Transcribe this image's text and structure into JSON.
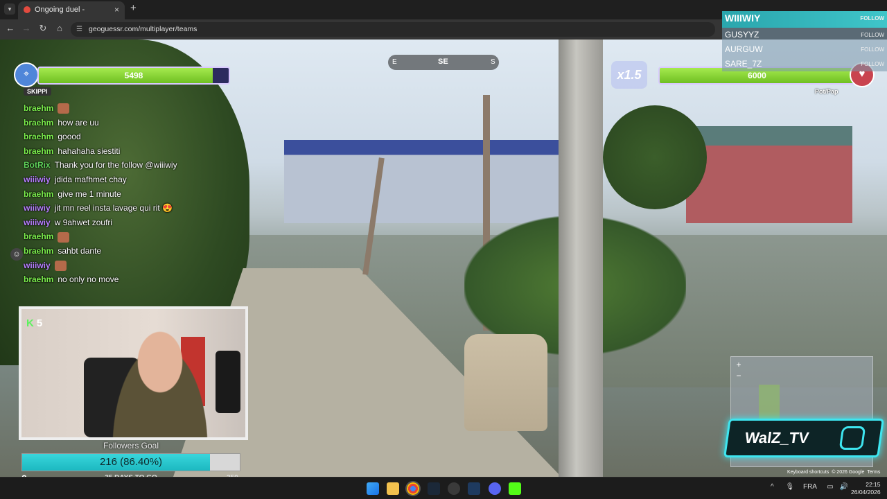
{
  "browser": {
    "tab_title": "Ongoing duel - GeoGuessr",
    "tab_close": "×",
    "new_tab": "+",
    "url": "geoguessr.com/multiplayer/teams"
  },
  "game": {
    "left_hp": "5498",
    "left_hp_fraction": 0.916,
    "right_hp": "6000",
    "right_hp_fraction": 1.0,
    "compass_left": "E",
    "compass_center": "SE",
    "compass_right": "S",
    "multiplier": "x1.5",
    "left_player_tag": "SKIPPI",
    "right_player_tag": "Pot/Pap"
  },
  "chat": [
    {
      "user": "braehm",
      "text": "",
      "color": "#7cf04d",
      "emote": true
    },
    {
      "user": "braehm",
      "text": "how are uu",
      "color": "#7cf04d"
    },
    {
      "user": "braehm",
      "text": "goood",
      "color": "#7cf04d"
    },
    {
      "user": "braehm",
      "text": "hahahaha siestiti",
      "color": "#7cf04d"
    },
    {
      "user": "BotRix",
      "text": "Thank you for the follow @wiiiwiy",
      "color": "#5fd35a"
    },
    {
      "user": "wiiiwiy",
      "text": "jdida mafhmet chay",
      "color": "#b780ff"
    },
    {
      "user": "braehm",
      "text": "give me 1 minute",
      "color": "#7cf04d"
    },
    {
      "user": "wiiiwiy",
      "text": "jit mn reel insta lavage qui rit 😍",
      "color": "#b780ff"
    },
    {
      "user": "wiiiwiy",
      "text": "w 9ahwet zoufri",
      "color": "#b780ff"
    },
    {
      "user": "braehm",
      "text": "",
      "color": "#7cf04d",
      "emote": true
    },
    {
      "user": "braehm",
      "text": "sahbt dante",
      "color": "#7cf04d"
    },
    {
      "user": "wiiiwiy",
      "text": "",
      "color": "#b780ff",
      "emote": true
    },
    {
      "user": "braehm",
      "text": "no only no move",
      "color": "#7cf04d"
    }
  ],
  "cam": {
    "kick_letter": "K",
    "viewers": "5"
  },
  "followers_goal": {
    "title": "Followers Goal",
    "value_text": "216 (86.40%)",
    "fraction": 0.864,
    "min": "0",
    "max": "250",
    "days_left": "35 DAYS TO GO"
  },
  "recent_followers": [
    {
      "name": "WIIIWIY",
      "follow": "FOLLOW",
      "highlight": true
    },
    {
      "name": "GUSYYZ",
      "follow": "FOLLOW"
    },
    {
      "name": "AURGUW",
      "follow": "FOLLOW"
    },
    {
      "name": "SARE_7Z",
      "follow": "FOLLOW"
    }
  ],
  "branding": {
    "channel": "WalZ_TV"
  },
  "map_footer": {
    "shortcuts": "Keyboard shortcuts",
    "copyright": "© 2026 Google",
    "terms": "Terms"
  },
  "taskbar": {
    "lang": "FRA",
    "time": "22:15",
    "date": "26/04/2026"
  },
  "colors": {
    "hp_green": "#8fdc3a",
    "goal_cyan": "#2cc9d0",
    "brand_cyan": "#3ee6f0"
  }
}
